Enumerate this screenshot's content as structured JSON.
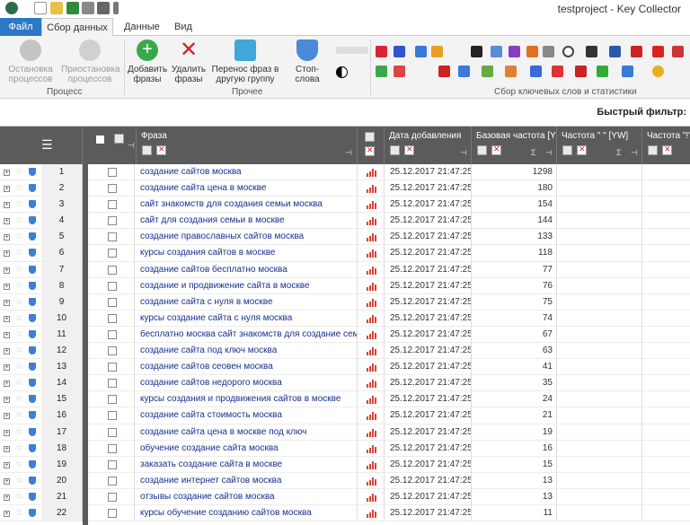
{
  "window": {
    "title": "testproject - Key Collector"
  },
  "tabs": [
    "Файл",
    "Сбор данных",
    "Данные",
    "Вид"
  ],
  "ribbon": {
    "buttons": {
      "stop": "Остановка процессов",
      "pause": "Приостановка процессов",
      "add": "Добавить фразы",
      "delete": "Удалить фразы",
      "move": "Перенос фраз в другую группу",
      "stopwords": "Стоп-слова"
    },
    "groups": {
      "process": "Процесс",
      "other": "Прочее",
      "collect": "Сбор ключевых слов и статистики"
    }
  },
  "filter": {
    "label": "Быстрый фильтр:"
  },
  "columns": {
    "phrase": "Фраза",
    "date": "Дата добавления",
    "base_freq": "Базовая частота [Y",
    "freq_quoted": "Частота \" \" [YW]",
    "freq_excl": "Частота \"!\""
  },
  "rows": [
    {
      "n": "1",
      "phrase": "создание сайтов москва",
      "date": "25.12.2017 21:47:25",
      "base": "1298"
    },
    {
      "n": "2",
      "phrase": "создание сайта цена в москве",
      "date": "25.12.2017 21:47:25",
      "base": "180"
    },
    {
      "n": "3",
      "phrase": "сайт знакомств для создания семьи москва",
      "date": "25.12.2017 21:47:25",
      "base": "154"
    },
    {
      "n": "4",
      "phrase": "сайт для создания семьи в москве",
      "date": "25.12.2017 21:47:25",
      "base": "144"
    },
    {
      "n": "5",
      "phrase": "создание православных сайтов москва",
      "date": "25.12.2017 21:47:25",
      "base": "133"
    },
    {
      "n": "6",
      "phrase": "курсы создания сайтов в москве",
      "date": "25.12.2017 21:47:25",
      "base": "118"
    },
    {
      "n": "7",
      "phrase": "создание сайтов бесплатно москва",
      "date": "25.12.2017 21:47:25",
      "base": "77"
    },
    {
      "n": "8",
      "phrase": "создание и продвижение сайта в москве",
      "date": "25.12.2017 21:47:25",
      "base": "76"
    },
    {
      "n": "9",
      "phrase": "создание сайта с нуля в москве",
      "date": "25.12.2017 21:47:25",
      "base": "75"
    },
    {
      "n": "10",
      "phrase": "курсы создание сайта с нуля москва",
      "date": "25.12.2017 21:47:25",
      "base": "74"
    },
    {
      "n": "11",
      "phrase": "бесплатно москва сайт знакомств для создание семьи",
      "date": "25.12.2017 21:47:25",
      "base": "67"
    },
    {
      "n": "12",
      "phrase": "создание сайта под ключ москва",
      "date": "25.12.2017 21:47:25",
      "base": "63"
    },
    {
      "n": "13",
      "phrase": "создание сайтов сеовен москва",
      "date": "25.12.2017 21:47:25",
      "base": "41"
    },
    {
      "n": "14",
      "phrase": "создание сайтов недорого москва",
      "date": "25.12.2017 21:47:25",
      "base": "35"
    },
    {
      "n": "15",
      "phrase": "курсы создания и продвижения сайтов в москве",
      "date": "25.12.2017 21:47:25",
      "base": "24"
    },
    {
      "n": "16",
      "phrase": "создание сайта стоимость москва",
      "date": "25.12.2017 21:47:25",
      "base": "21"
    },
    {
      "n": "17",
      "phrase": "создание сайта цена в москве под ключ",
      "date": "25.12.2017 21:47:25",
      "base": "19"
    },
    {
      "n": "18",
      "phrase": "обучение создание сайта москва",
      "date": "25.12.2017 21:47:25",
      "base": "16"
    },
    {
      "n": "19",
      "phrase": "заказать создание сайта в москве",
      "date": "25.12.2017 21:47:25",
      "base": "15"
    },
    {
      "n": "20",
      "phrase": "создание интернет сайтов москва",
      "date": "25.12.2017 21:47:25",
      "base": "13"
    },
    {
      "n": "21",
      "phrase": "отзывы создание сайтов москва",
      "date": "25.12.2017 21:47:25",
      "base": "13"
    },
    {
      "n": "22",
      "phrase": "курсы обучение созданию сайтов москва",
      "date": "25.12.2017 21:47:25",
      "base": "11"
    }
  ]
}
